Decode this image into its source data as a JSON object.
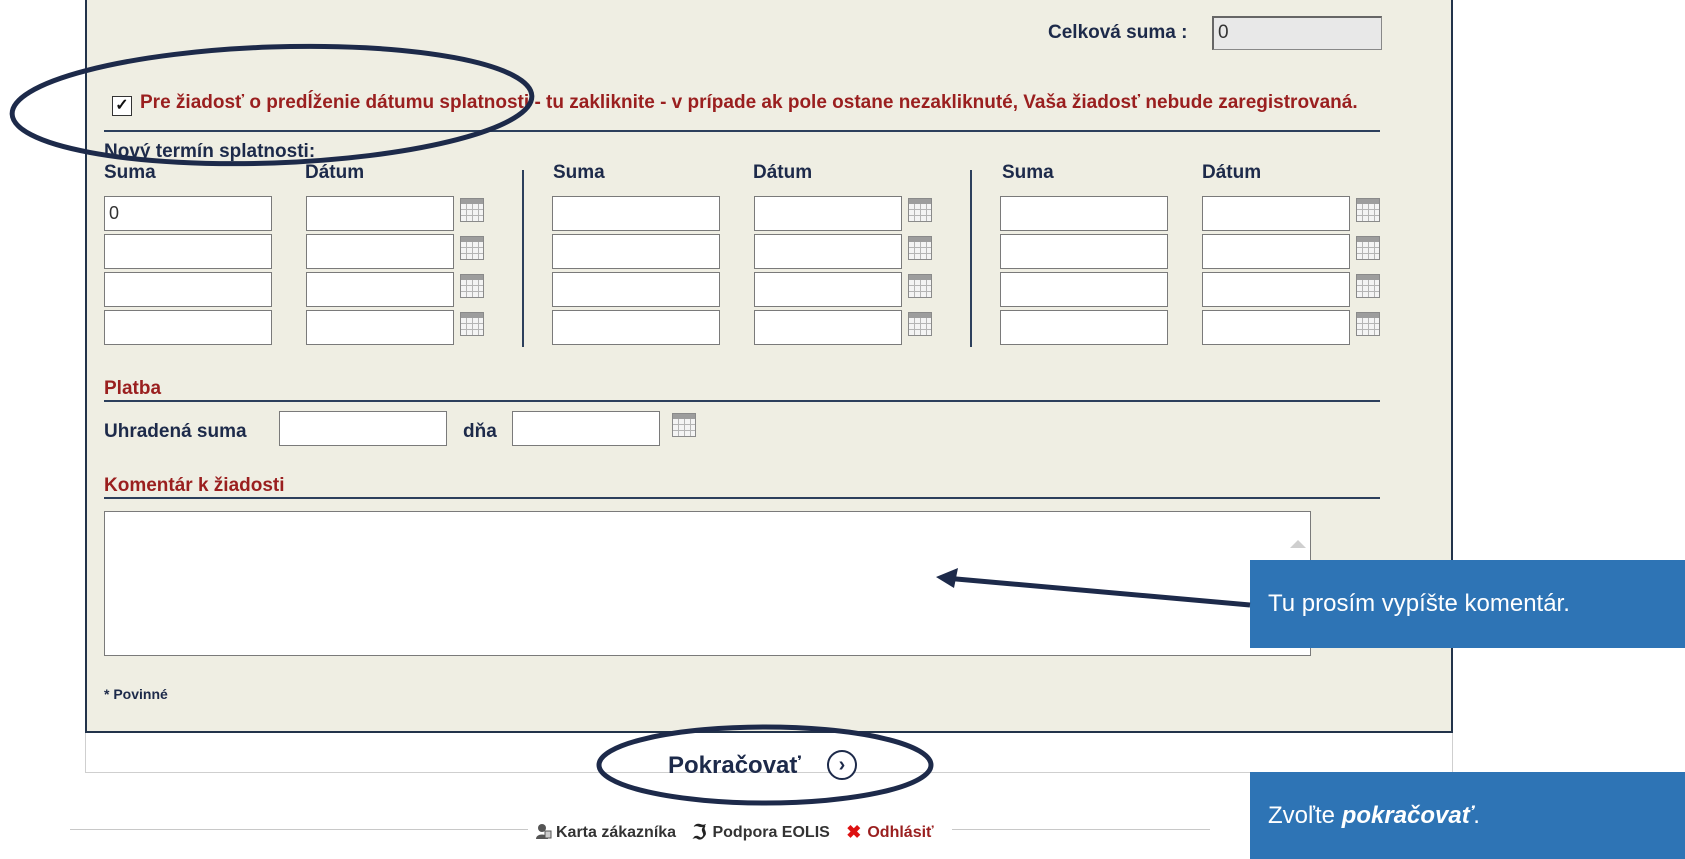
{
  "total": {
    "label": "Celková suma :",
    "value": "0"
  },
  "agreement": {
    "checked": "✓",
    "text": "Pre žiadosť o predĺženie dátumu splatnosti - tu zakliknite - v prípade ak pole ostane nezakliknuté, Vaša žiadosť nebude zaregistrovaná."
  },
  "new_due": {
    "heading": "Nový termín splatnosti:",
    "col_sum": "Suma",
    "col_date": "Dátum",
    "first_sum_value": "0"
  },
  "payment": {
    "heading": "Platba",
    "paid_label": "Uhradená suma",
    "date_label": "dňa"
  },
  "comment": {
    "heading": "Komentár k žiadosti"
  },
  "required_note": "* Povinné",
  "continue": {
    "label": "Pokračovať",
    "icon": "chevron-right-icon"
  },
  "footer_links": {
    "customer_card": "Karta zákazníka",
    "support": "Podpora EOLIS",
    "logout": "Odhlásiť"
  },
  "tooltips": {
    "comment_tip": "Tu prosím vypíšte komentár.",
    "continue_prefix": "Zvoľte ",
    "continue_emph": "pokračovať",
    "continue_suffix": "."
  },
  "colors": {
    "panel_bg": "#efeee3",
    "navy": "#1d2a4a",
    "dark_red": "#9a1f1f",
    "callout_blue": "#2e74b5"
  }
}
